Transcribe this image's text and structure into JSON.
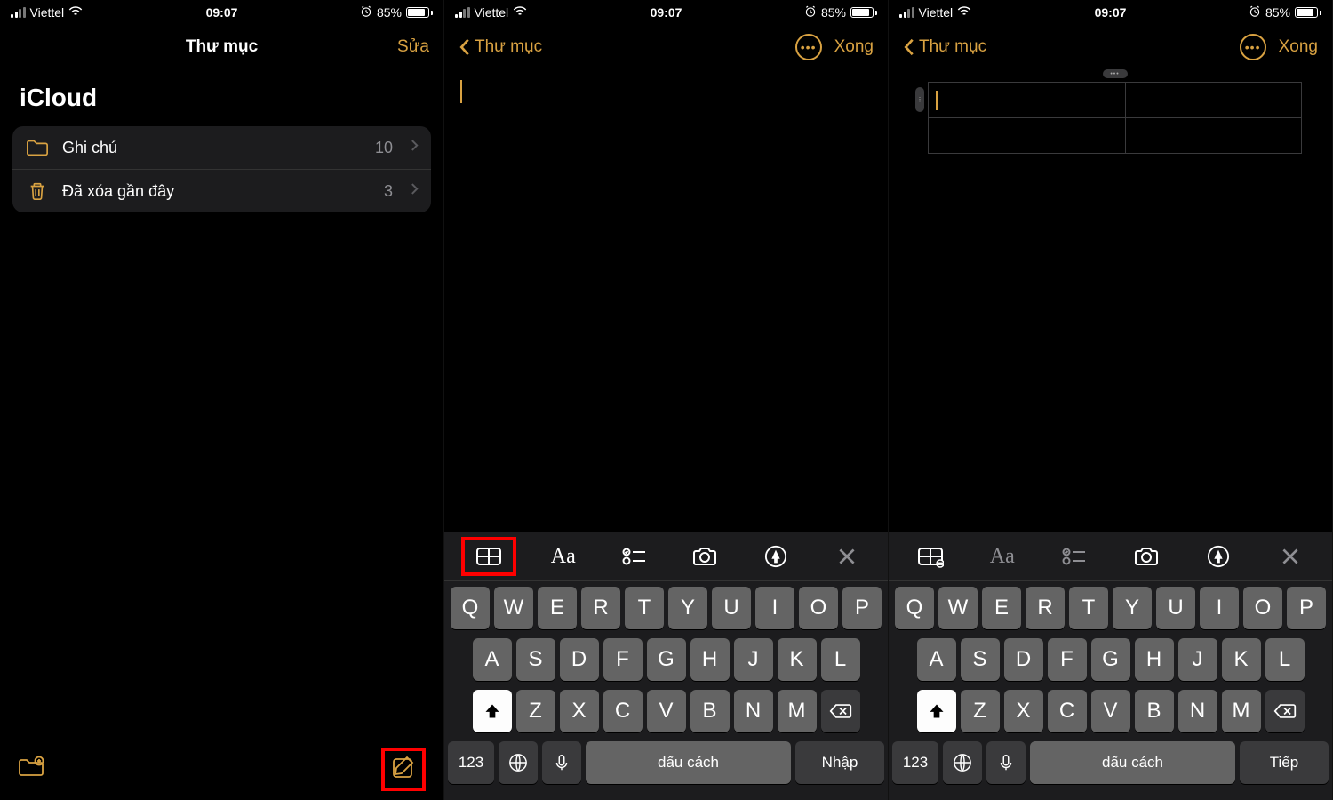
{
  "status": {
    "carrier": "Viettel",
    "time": "09:07",
    "battery_pct": "85%"
  },
  "screen1": {
    "title": "Thư mục",
    "edit": "Sửa",
    "section": "iCloud",
    "folders": [
      {
        "label": "Ghi chú",
        "count": "10"
      },
      {
        "label": "Đã xóa gần đây",
        "count": "3"
      }
    ]
  },
  "screen2": {
    "back": "Thư mục",
    "done": "Xong",
    "keyboard_return": "Nhập"
  },
  "screen3": {
    "back": "Thư mục",
    "done": "Xong",
    "keyboard_return": "Tiếp"
  },
  "keyboard": {
    "row1": [
      "Q",
      "W",
      "E",
      "R",
      "T",
      "Y",
      "U",
      "I",
      "O",
      "P"
    ],
    "row2": [
      "A",
      "S",
      "D",
      "F",
      "G",
      "H",
      "J",
      "K",
      "L"
    ],
    "row3": [
      "Z",
      "X",
      "C",
      "V",
      "B",
      "N",
      "M"
    ],
    "num": "123",
    "space": "dấu cách"
  }
}
